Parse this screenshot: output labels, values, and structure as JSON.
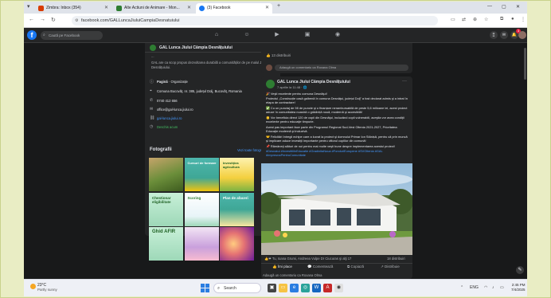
{
  "browser": {
    "tabs": [
      {
        "label": "Zimbra: Inbox (354)",
        "favicon_color": "#d83b01"
      },
      {
        "label": "Alte Actiuni de Animare - Mon...",
        "favicon_color": "#2e7d32"
      },
      {
        "label": "(3) Facebook",
        "favicon_color": "#1877f2"
      }
    ],
    "new_tab": "+",
    "url": "facebook.com/GALLuncaJiuluiCampiaDesnatuiului"
  },
  "facebook": {
    "logo": "f",
    "search_placeholder": "Caută pe Facebook",
    "notification_count": "3",
    "page_name": "GAL Lunca Jiului Câmpia Desnățuiului",
    "intro": {
      "header_partial": "...",
      "description": "GAL are ca scop propus dezvoltarea durabilă a comunităților de pe malul Jiului și Desnățuiului.",
      "category_label": "Pagină",
      "category": "Organizație",
      "address": "Comuna Bucovăț, nr. 385, județul Dolj, Bucovăț, Romania",
      "phone": "0740 412 656",
      "email": "office@gal-lunca.jiului.ro",
      "website": "gal-lunca.jiului.ro",
      "status": "Deschis acum"
    },
    "photos": {
      "title": "Fotografii",
      "see_all": "Vezi toate fotografiile",
      "items": [
        {
          "caption": "",
          "bg": "#6b8e3a"
        },
        {
          "caption": "Cursuri de formare",
          "bg": "#3fa796"
        },
        {
          "caption": "Investiţiea agricultura",
          "bg": "#f4d03f"
        },
        {
          "caption": "Chestionar eligibilitate",
          "bg": "#9ed8b8"
        },
        {
          "caption": "Scoring",
          "bg": "#e8f4f8"
        },
        {
          "caption": "Plan de afaceri",
          "bg": "#3fa796"
        },
        {
          "caption": "Ghid AFIR",
          "bg": "#9ed8b8"
        },
        {
          "caption": "",
          "bg": "#c9a0dc"
        },
        {
          "caption": "",
          "bg": "#e57373"
        }
      ]
    },
    "top_strip": {
      "meta": "13 distribuiri",
      "comment_placeholder": "Adaugă un comentariu ca Roxana Olma"
    },
    "post": {
      "author": "GAL Lunca Jiului Câmpia Desnățuiului",
      "time": "7 aprilie la 11:48 · 🌐",
      "lines": [
        "🎉 Veşti excelente pentru comuna Desnăţui!",
        "Proiectul „Construcție casă galbenă în comuna Desnăţui, județul Dolj” a fost declarat admis şi a intrat în etapa de contractare!",
        "✅ Cu un punctaj de 98 de puncte şi o finanțare nerambursabilă de peste 5,6 milioane lei, acest proiect aduce în comunitatea noastră o grădiniță nouă, modernă şi accesibilă!",
        "👶 Vor beneficia direct 120 de copii din Desnăţui, incluzând copii vulnerabili, aceştia vor avea condiţii excelente pentru educaţie timpurie.",
        "Acest pas important face parte din Programul Regional Sud-Vest Oltenia 2021-2027, Prioritatea: Educaţie modernă şi incluzivă.",
        "🤝 Felicitări întregii echipe care a lucrat la proiect şi domnului Primar Ion Stănișă, pentru că prin muncă şi implicare aduce investiţii importante pentru viitorul copiilor din comună!",
        "📌 Rămâneţi alături de noi pentru mai multe veşti bune despre implementarea acestui proiect!"
      ],
      "tags": "#Desnatui #InvestitiiInEducatie #GradinitaNoua #FonduriEuropene #SVOltenia #GAL #ImpreunaPentruComunitate",
      "reactions_text": "Tu, Ioana Grumi, Andreea Vulpe Dr Ciucuras şi alţi 17",
      "shares_text": "18 distribuiri",
      "actions": [
        "Îmi place",
        "Comentează",
        "Copiază",
        "Distribuie"
      ],
      "comment_placeholder": "Adaugă un comentariu ca Roxana Olma"
    }
  },
  "taskbar": {
    "weather_temp": "23°C",
    "weather_desc": "Partly sunny",
    "search_label": "Search",
    "lang": "ENG",
    "time": "2:45 PM",
    "date": "7/4/2025"
  }
}
